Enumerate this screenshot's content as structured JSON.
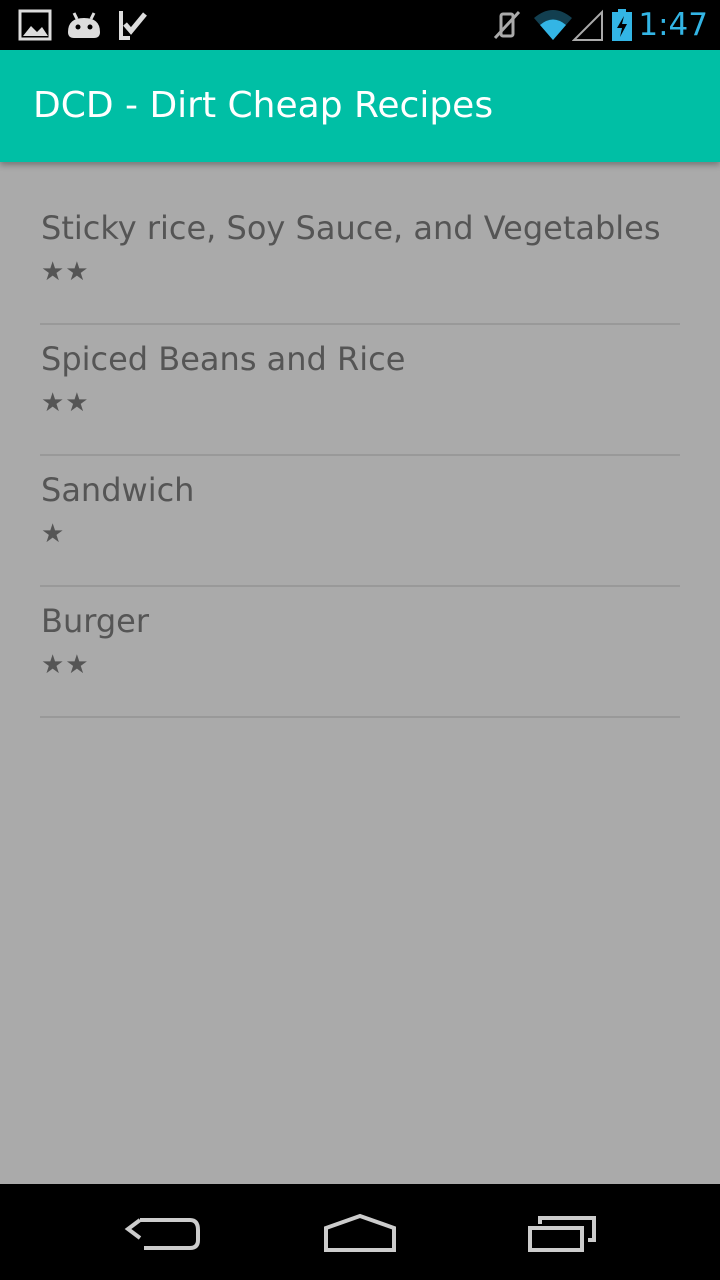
{
  "status_bar": {
    "time": "1:47",
    "notification_icons": [
      "gallery-icon",
      "android-icon",
      "checkmark-icon"
    ],
    "system_icons": [
      "vibrate-off-icon",
      "wifi-icon",
      "signal-icon",
      "battery-charging-icon"
    ],
    "time_color": "#33b5e5"
  },
  "app_bar": {
    "title": "DCD - Dirt Cheap Recipes",
    "color": "#00bfa5"
  },
  "recipes": [
    {
      "name": "Sticky rice, Soy Sauce, and Vegetables",
      "rating": "★★"
    },
    {
      "name": "Spiced Beans and Rice",
      "rating": "★★"
    },
    {
      "name": "Sandwich",
      "rating": "★"
    },
    {
      "name": "Burger",
      "rating": "★★"
    }
  ],
  "nav_bar": {
    "buttons": [
      "back-icon",
      "home-icon",
      "recents-icon"
    ]
  }
}
